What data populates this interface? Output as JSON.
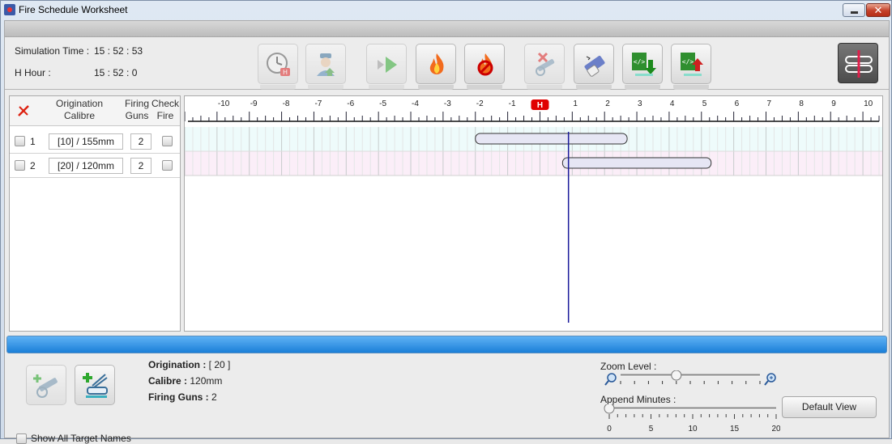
{
  "window": {
    "title": "Fire Schedule Worksheet"
  },
  "toolbar": {
    "sim_time_label": "Simulation Time :",
    "sim_time_value": "15 : 52 : 53",
    "h_hour_label": "H Hour :",
    "h_hour_value": "15 : 52 : 0",
    "buttons": [
      {
        "name": "set-h-hour-button",
        "icon": "clock-h-icon",
        "enabled": false
      },
      {
        "name": "assign-officer-button",
        "icon": "officer-icon",
        "enabled": false
      },
      {
        "name": "play-fire-button",
        "icon": "play-icon",
        "enabled": false
      },
      {
        "name": "fire-button",
        "icon": "flame-icon",
        "enabled": true
      },
      {
        "name": "cease-fire-button",
        "icon": "flame-stop-icon",
        "enabled": true
      },
      {
        "name": "remove-gun-button",
        "icon": "cannon-remove-icon",
        "enabled": false
      },
      {
        "name": "erase-button",
        "icon": "eraser-icon",
        "enabled": true
      },
      {
        "name": "import-xml-button",
        "icon": "xml-import-icon",
        "enabled": true
      },
      {
        "name": "export-xml-button",
        "icon": "xml-export-icon",
        "enabled": true
      }
    ],
    "view_toggle_icon": "schedule-view-icon"
  },
  "grid": {
    "clear_icon": "red-x-icon",
    "header_origination": "Origination",
    "header_calibre": "Calibre",
    "header_firing": "Firing",
    "header_guns": "Guns",
    "header_check": "Check",
    "header_fire": "Fire",
    "rows": [
      {
        "index": "1",
        "calibre": "[10] / 155mm",
        "guns": "2",
        "start": -2,
        "end": 2.7,
        "color": "#eefbfb"
      },
      {
        "index": "2",
        "calibre": "[20] / 120mm",
        "guns": "2",
        "start": 0.7,
        "end": 5.3,
        "color": "#fbeef8"
      }
    ]
  },
  "timeline": {
    "min": -11,
    "max": 10.6,
    "h_label": "H",
    "ticks": [
      "-10",
      "-9",
      "-8",
      "-7",
      "-6",
      "-5",
      "-4",
      "-3",
      "-2",
      "-1",
      "1",
      "2",
      "3",
      "4",
      "5",
      "6",
      "7",
      "8",
      "9",
      "10"
    ],
    "current_time": 0.8833,
    "line_color": "#1a1a9a",
    "h_color": "#e00000"
  },
  "details": {
    "origination_label": "Origination :",
    "origination_value": "[ 20 ]",
    "calibre_label": "Calibre :",
    "calibre_value": "120mm",
    "firing_guns_label": "Firing Guns :",
    "firing_guns_value": "2",
    "show_all_label": "Show All Target Names",
    "add_gun_icon": "cannon-add-icon",
    "add_target_icon": "target-add-icon"
  },
  "zoom": {
    "zoom_label": "Zoom Level :",
    "zoom_level": 0.4,
    "append_label": "Append Minutes :",
    "append_value": 0,
    "append_ticks": [
      "0",
      "5",
      "10",
      "15",
      "20"
    ],
    "default_view_label": "Default View"
  }
}
